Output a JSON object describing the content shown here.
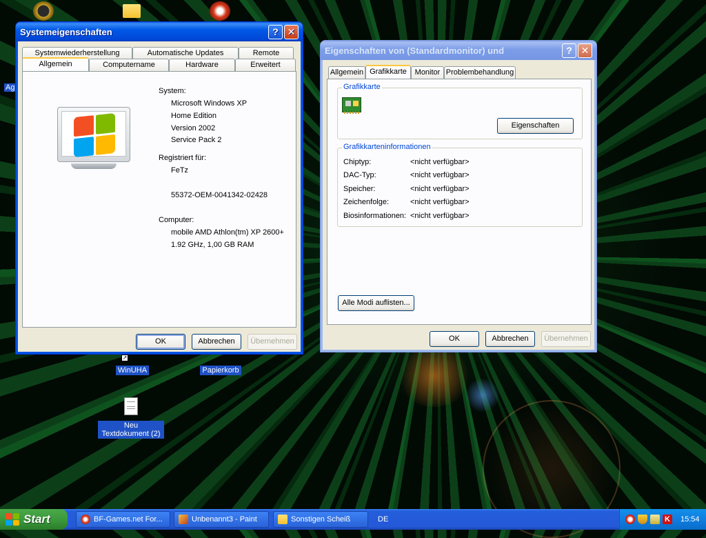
{
  "desktop": {
    "icons": [
      {
        "label": "WinUHA"
      },
      {
        "label": "Papierkorb"
      },
      {
        "label": "Neu Textdokument (2)"
      }
    ],
    "partial_label": "Ag"
  },
  "sysprops": {
    "title": "Systemeigenschaften",
    "tabs_top": [
      "Systemwiederherstellung",
      "Automatische Updates",
      "Remote"
    ],
    "tabs_bottom": [
      "Allgemein",
      "Computername",
      "Hardware",
      "Erweitert"
    ],
    "system_label": "System:",
    "system_lines": [
      "Microsoft Windows XP",
      "Home Edition",
      "Version 2002",
      "Service Pack 2"
    ],
    "registered_label": "Registriert für:",
    "registered_user": "FeTz",
    "product_id": "55372-OEM-0041342-02428",
    "computer_label": "Computer:",
    "computer_lines": [
      "mobile AMD Athlon(tm) XP 2600+",
      "1.92 GHz, 1,00 GB RAM"
    ],
    "ok": "OK",
    "cancel": "Abbrechen",
    "apply": "Übernehmen"
  },
  "monitor": {
    "title": "Eigenschaften von (Standardmonitor) und",
    "tabs": [
      "Allgemein",
      "Grafikkarte",
      "Monitor",
      "Problembehandlung"
    ],
    "selected_tab": "Grafikkarte",
    "adapter_group": "Grafikkarte",
    "properties_button": "Eigenschaften",
    "info_group": "Grafikkarteninformationen",
    "info_rows": [
      {
        "label": "Chiptyp:",
        "value": "<nicht verfügbar>"
      },
      {
        "label": "DAC-Typ:",
        "value": "<nicht verfügbar>"
      },
      {
        "label": "Speicher:",
        "value": "<nicht verfügbar>"
      },
      {
        "label": "Zeichenfolge:",
        "value": "<nicht verfügbar>"
      },
      {
        "label": "Biosinformationen:",
        "value": "<nicht verfügbar>"
      }
    ],
    "list_modes": "Alle Modi auflisten...",
    "ok": "OK",
    "cancel": "Abbrechen",
    "apply": "Übernehmen"
  },
  "taskbar": {
    "start": "Start",
    "items": [
      "BF-Games.net For...",
      "Unbenannt3 - Paint",
      "Sonstigen Scheiß"
    ],
    "language": "DE",
    "clock": "15:54"
  },
  "colors": {
    "xp_blue": "#0054e3",
    "start_green": "#3c9a3c",
    "group_title_blue": "#0046d5"
  }
}
